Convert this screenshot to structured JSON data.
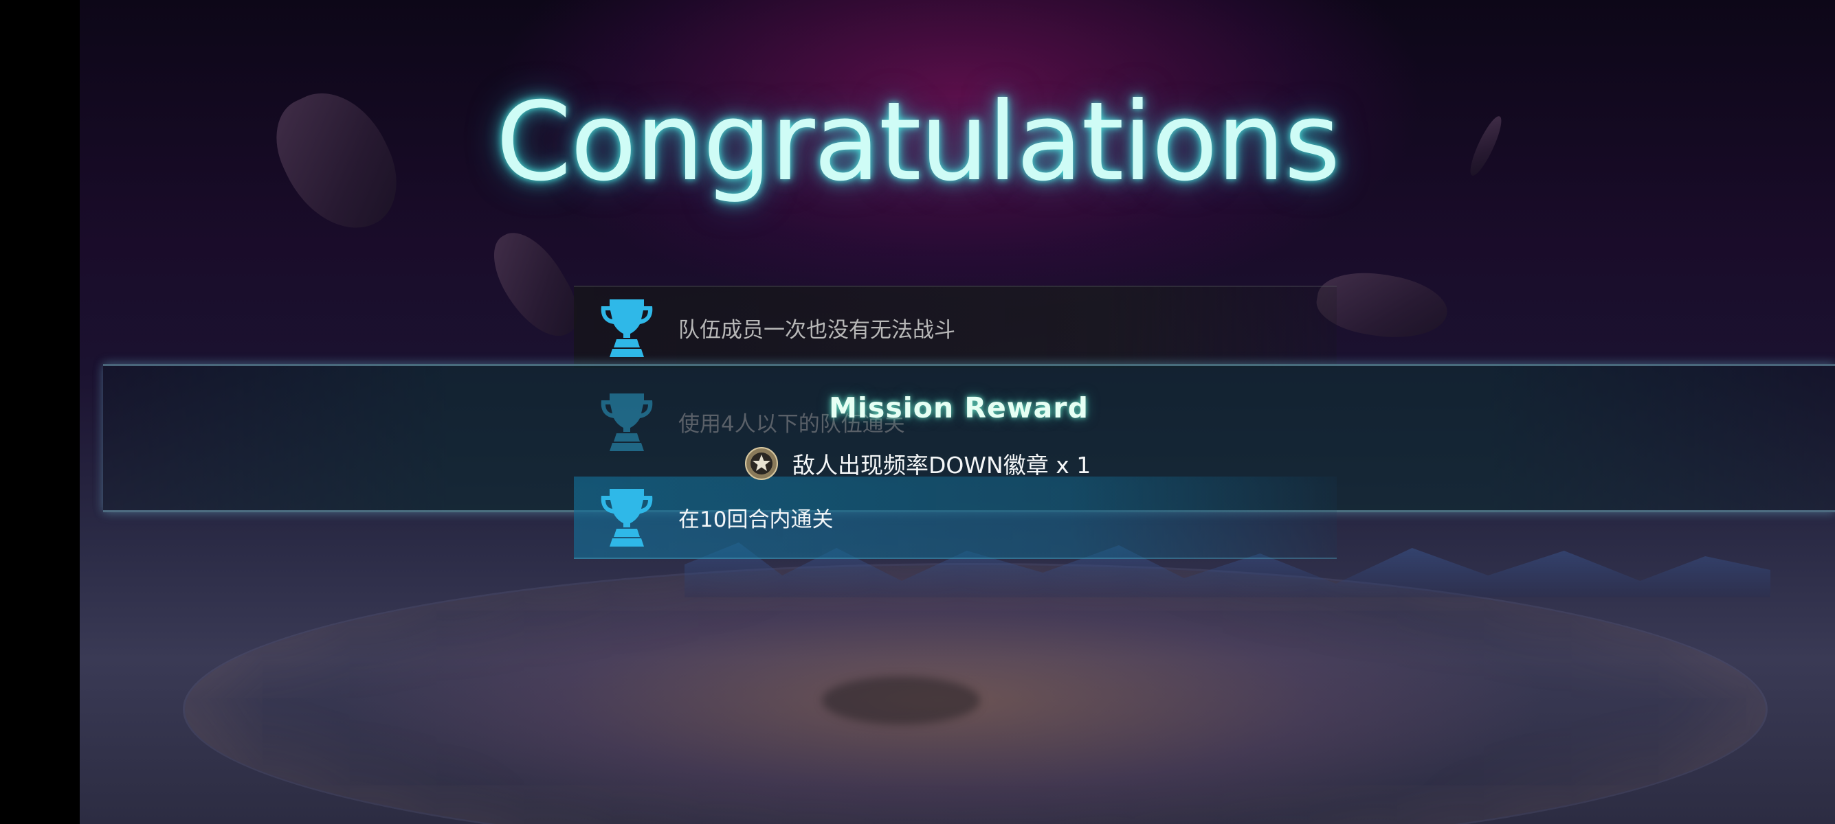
{
  "screen": {
    "title": "Congratulations"
  },
  "missions": [
    {
      "text": "队伍成员一次也没有无法战斗",
      "icon": "trophy-icon",
      "state": "cleared"
    },
    {
      "text": "使用4人以下的队伍通关",
      "icon": "trophy-icon",
      "state": "dimmed"
    },
    {
      "text": "在10回合内通关",
      "icon": "trophy-icon",
      "state": "highlighted"
    }
  ],
  "reward": {
    "title": "Mission Reward",
    "item_text": "敌人出现频率DOWN徽章 x 1",
    "item_icon": "star-badge-icon"
  },
  "colors": {
    "title_glow": "#50f0e6",
    "trophy": "#2fb8e8",
    "highlight_row": "#14698f"
  }
}
